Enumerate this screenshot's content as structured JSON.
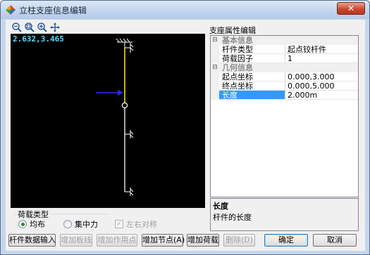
{
  "window": {
    "title": "立柱支座信息编辑",
    "close_label": "✕"
  },
  "toolbar": {
    "icons": [
      "zoom-out-icon",
      "zoom-fit-icon",
      "zoom-in-icon",
      "pan-icon"
    ]
  },
  "canvas": {
    "coord_text": "2.632,3.465"
  },
  "load_type": {
    "label": "荷载类型",
    "options": [
      "均布",
      "集中力"
    ],
    "selected": "均布"
  },
  "symmetry": {
    "label": "左右对称",
    "checked": true,
    "enabled": false
  },
  "buttons": {
    "member_input": "杆件数据输入",
    "add_plank": "增加板线",
    "add_action_point": "增加作用点",
    "add_node": "增加节点(A)",
    "add_load": "增加荷载",
    "delete": "删除(D)",
    "ok": "确定",
    "cancel": "取消"
  },
  "properties": {
    "title": "支座属性编辑",
    "categories": [
      {
        "name": "基本信息",
        "items": [
          {
            "key": "杆件类型",
            "value": "起点铰杆件"
          },
          {
            "key": "荷载因子",
            "value": "1"
          }
        ]
      },
      {
        "name": "几何信息",
        "items": [
          {
            "key": "起点坐标",
            "value": "0.000,3.000"
          },
          {
            "key": "终点坐标",
            "value": "0.000,5.000"
          },
          {
            "key": "长度",
            "value": "2.000m"
          }
        ]
      }
    ],
    "selected_key": "长度",
    "description": {
      "title": "长度",
      "text": "杆件的长度"
    }
  },
  "colors": {
    "member_selected": "#ffd800",
    "member": "#ffffff",
    "load_arrow": "#2b2bff",
    "coord_text": "#4fe0ff",
    "selection": "#3399ff"
  }
}
